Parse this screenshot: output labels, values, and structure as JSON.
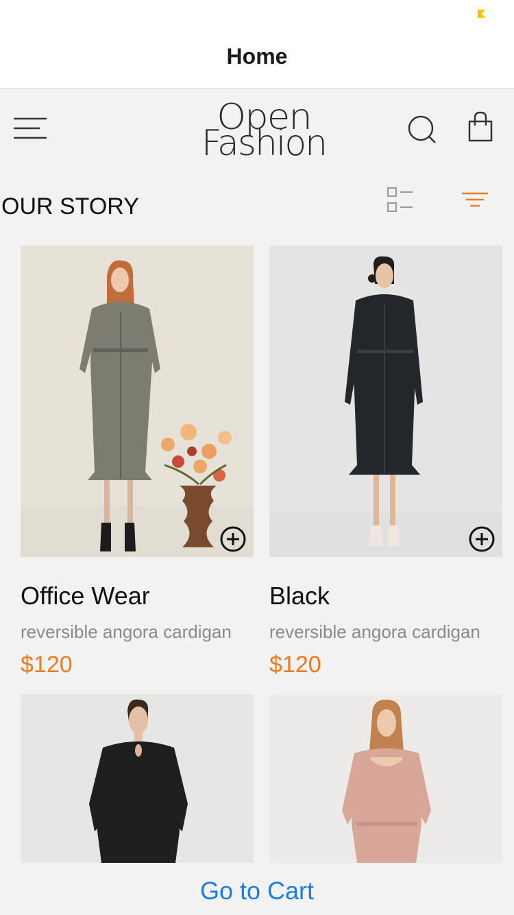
{
  "navbar": {
    "title": "Home"
  },
  "header": {
    "logo_line1": "Open",
    "logo_line2": "Fashion"
  },
  "section": {
    "title": "OUR STORY"
  },
  "products": [
    {
      "name": "Office Wear",
      "description": "reversible angora cardigan",
      "price": "$120"
    },
    {
      "name": "Black",
      "description": "reversible angora cardigan",
      "price": "$120"
    },
    {
      "name": "",
      "description": "",
      "price": ""
    },
    {
      "name": "",
      "description": "",
      "price": ""
    }
  ],
  "bottom": {
    "cart_label": "Go to Cart"
  },
  "colors": {
    "accent": "#ef7a1f",
    "link": "#1a7de6",
    "status_indicator": "#f5c800"
  },
  "icons": {
    "menu": "menu-icon",
    "search": "search-icon",
    "bag": "shopping-bag-icon",
    "list_view": "list-view-icon",
    "filter": "filter-icon",
    "add": "plus-circle-icon"
  }
}
